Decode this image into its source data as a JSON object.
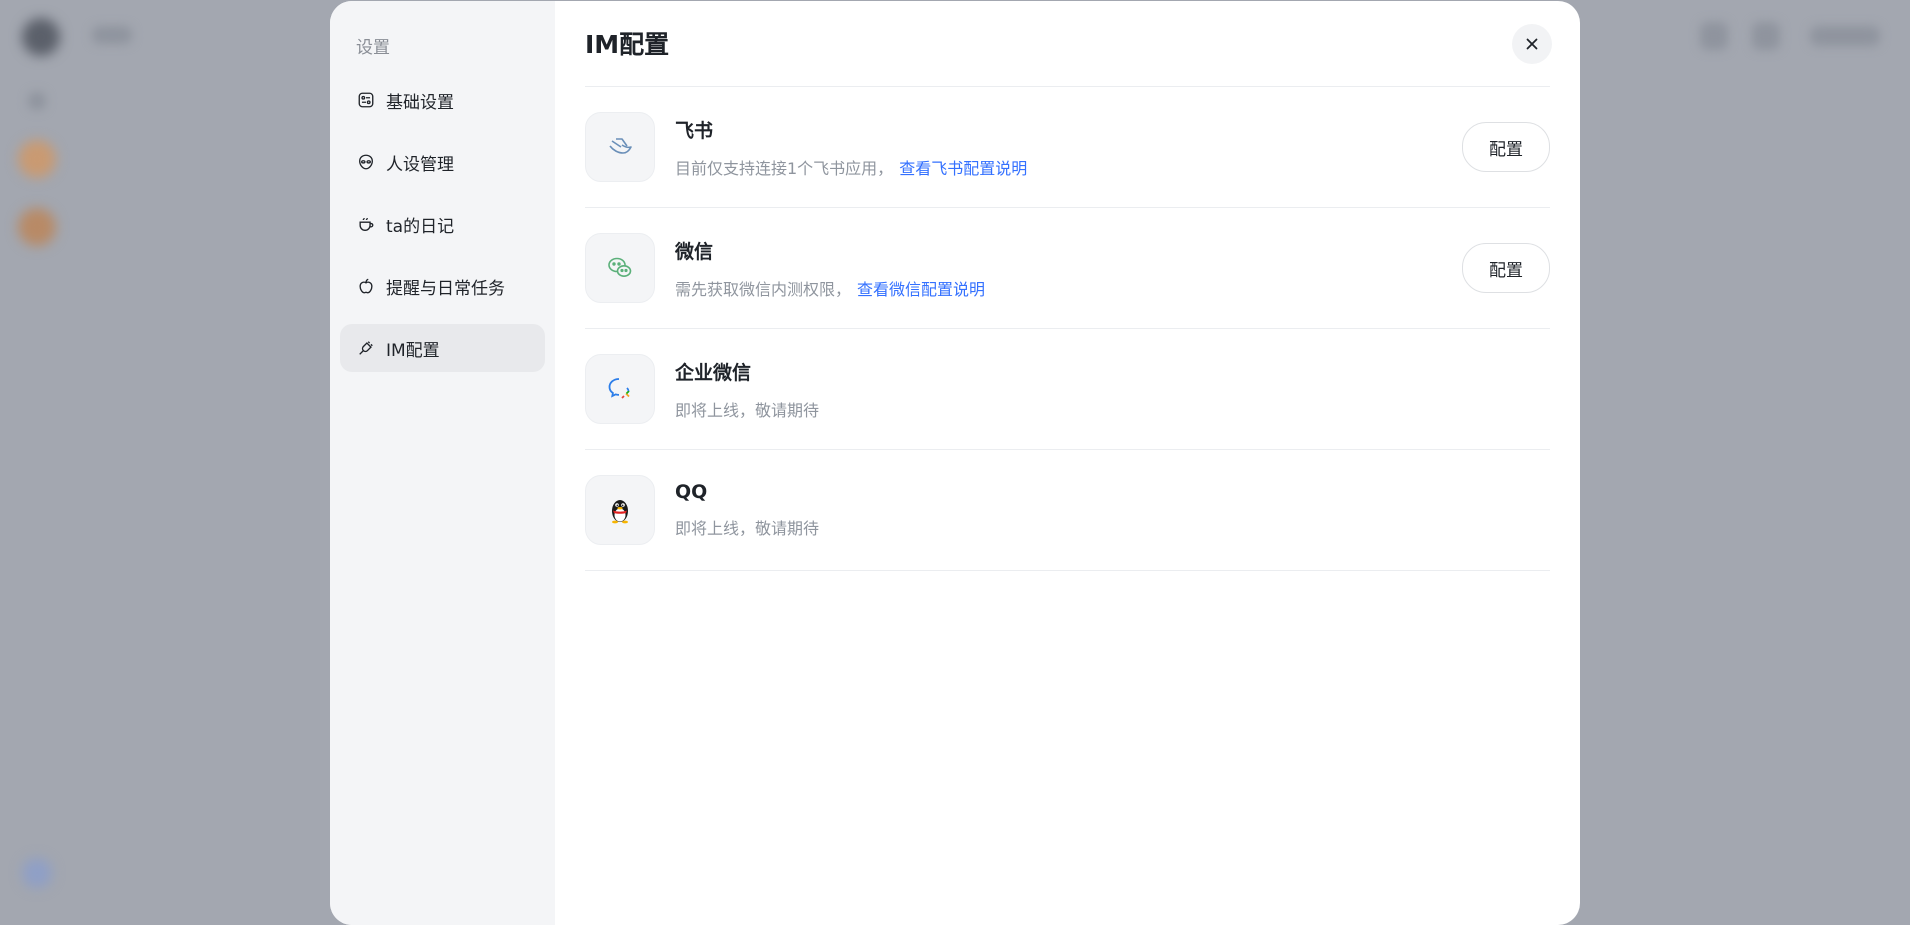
{
  "sidebar": {
    "title": "设置",
    "items": [
      {
        "label": "基础设置",
        "icon": "settings-panel-icon"
      },
      {
        "label": "人设管理",
        "icon": "persona-face-icon"
      },
      {
        "label": "ta的日记",
        "icon": "coffee-cup-icon"
      },
      {
        "label": "提醒与日常任务",
        "icon": "apple-icon"
      },
      {
        "label": "IM配置",
        "icon": "plug-icon",
        "active": true
      }
    ]
  },
  "main": {
    "title": "IM配置",
    "integrations": [
      {
        "name": "飞书",
        "desc": "目前仅支持连接1个飞书应用，",
        "link": "查看飞书配置说明",
        "button": "配置",
        "icon": "feishu-icon"
      },
      {
        "name": "微信",
        "desc": "需先获取微信内测权限，",
        "link": "查看微信配置说明",
        "button": "配置",
        "icon": "wechat-icon"
      },
      {
        "name": "企业微信",
        "desc": "即将上线，敬请期待",
        "icon": "wecom-icon"
      },
      {
        "name": "QQ",
        "desc": "即将上线，敬请期待",
        "icon": "qq-penguin-icon"
      }
    ]
  },
  "colors": {
    "accent": "#3370ff",
    "wechat": "#5bb07a",
    "feishu": "#6a8fb8"
  }
}
